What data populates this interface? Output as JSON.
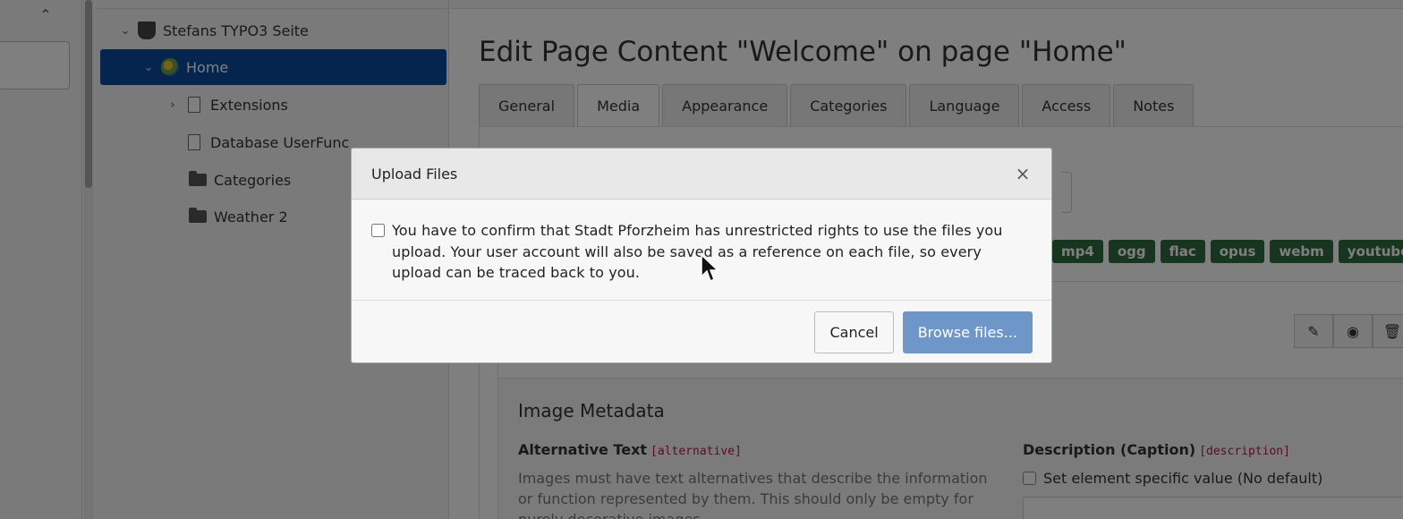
{
  "tree": {
    "nodes": [
      {
        "label": "Stefans TYPO3 Seite",
        "toggle": "⌄",
        "icon": "typo3-logo-icon"
      },
      {
        "label": "Home",
        "toggle": "⌄",
        "icon": "globe-icon"
      },
      {
        "label": "Extensions",
        "toggle": "›",
        "icon": "page-icon"
      },
      {
        "label": "Database UserFunc",
        "toggle": "",
        "icon": "page-icon"
      },
      {
        "label": "Categories",
        "toggle": "",
        "icon": "folder-icon"
      },
      {
        "label": "Weather 2",
        "toggle": "",
        "icon": "folder-icon"
      }
    ]
  },
  "main": {
    "title": "Edit Page Content \"Welcome\" on page \"Home\"",
    "tabs": [
      "General",
      "Media",
      "Appearance",
      "Categories",
      "Language",
      "Access",
      "Notes"
    ],
    "active_tab": "Media",
    "extensions": [
      "mp4",
      "ogg",
      "flac",
      "opus",
      "webm",
      "youtube"
    ],
    "metadata": {
      "title": "Image Metadata",
      "alt_label": "Alternative Text",
      "alt_code": "[alternative]",
      "alt_desc": "Images must have text alternatives that describe the information or function represented by them. This should only be empty for purely decorative images.",
      "desc_label": "Description (Caption)",
      "desc_code": "[description]",
      "desc_checkbox": "Set element specific value (No default)"
    }
  },
  "modal": {
    "title": "Upload Files",
    "close": "×",
    "confirm_text": "You have to confirm that Stadt Pforzheim has unrestricted rights to use the files you upload. Your user account will also be saved as a reference on each file, so every upload can be traced back to you.",
    "cancel_label": "Cancel",
    "browse_label": "Browse files..."
  },
  "colors": {
    "selected_node": "#0a4a9c",
    "primary_button": "#6f96c8",
    "extension_tag": "#2e6b3e",
    "field_code": "#b2185a"
  }
}
